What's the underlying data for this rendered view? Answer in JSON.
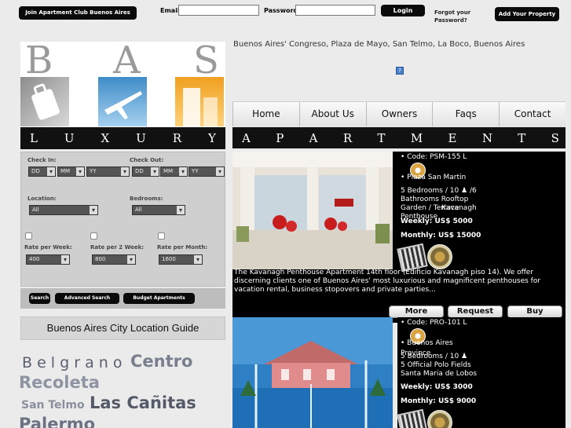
{
  "header": {
    "join_label": "Join Apartment Club Buenos Aires",
    "email_label": "Email",
    "password_label": "Password",
    "login_label": "Login",
    "forgot_label": "Forgot your Password?",
    "add_property_label": "Add Your Property"
  },
  "logo": {
    "letters": [
      "B",
      "A",
      "S"
    ],
    "tagline_letters": [
      "L",
      "U",
      "X",
      "U",
      "R",
      "Y"
    ]
  },
  "search": {
    "checkin_label": "Check In:",
    "checkout_label": "Check Out:",
    "checkin": {
      "day": "DD",
      "month": "MM",
      "year": "YY"
    },
    "checkout": {
      "day": "DD",
      "month": "MM",
      "year": "YY"
    },
    "location_label": "Location:",
    "location_value": "All",
    "bedrooms_label": "Bedrooms:",
    "bedrooms_value": "All",
    "rate_week_label": "Rate per Week:",
    "rate_week_value": "400",
    "rate_2week_label": "Rate per 2 Week:",
    "rate_2week_value": "800",
    "rate_month_label": "Rate per Month:",
    "rate_month_value": "1600",
    "search_button": "Search",
    "advanced_button": "Advanced Search",
    "budget_button": "Budget Apartments"
  },
  "guide_title": "Buenos Aires City Location Guide",
  "tag_cloud": [
    "B e l g r a n o",
    "Centro",
    "Recoleta",
    "San Telmo",
    "Las Cañitas",
    "Palermo"
  ],
  "location_line": "Buenos Aires' Congreso, Plaza de Mayo, San Telmo, La Boco, Buenos Aires",
  "nav": [
    "Home",
    "About Us",
    "Owners",
    "Faqs",
    "Contact"
  ],
  "apartments_letters": [
    "A",
    "P",
    "A",
    "R",
    "T",
    "M",
    "E",
    "N",
    "T",
    "S"
  ],
  "listings": [
    {
      "code": "• Code: PSM-155 L",
      "area": "• Plaza San Martin",
      "details": [
        "5 Bedrooms / 10 ♟ /6",
        "Bathrooms Rooftop",
        "Garden / Terrace",
        "Penthouse"
      ],
      "overlay": "Kavanagh",
      "weekly": "Weekly: US$ 5000",
      "monthly": "Monthly: US$ 15000",
      "description": "The Kavanagh Penthouse Apartment 14th floor (Edificio Kavanagh piso 14). We offer discerning clients one of Buenos Aires' most luxurious and magnificent penthouses for vacation rental, business stopovers and private parties...",
      "more": "More",
      "request": "Request",
      "buy": "Buy"
    },
    {
      "code": "• Code: PRO-101 L",
      "area": "• Buenos Aires",
      "area2": "Province",
      "details": [
        "5 Bedrooms / 10 ♟",
        "5 Official Polo Fields",
        "Santa Maria de Lobos"
      ],
      "weekly": "Weekly: US$ 3000",
      "monthly": "Monthly: US$ 9000"
    }
  ]
}
